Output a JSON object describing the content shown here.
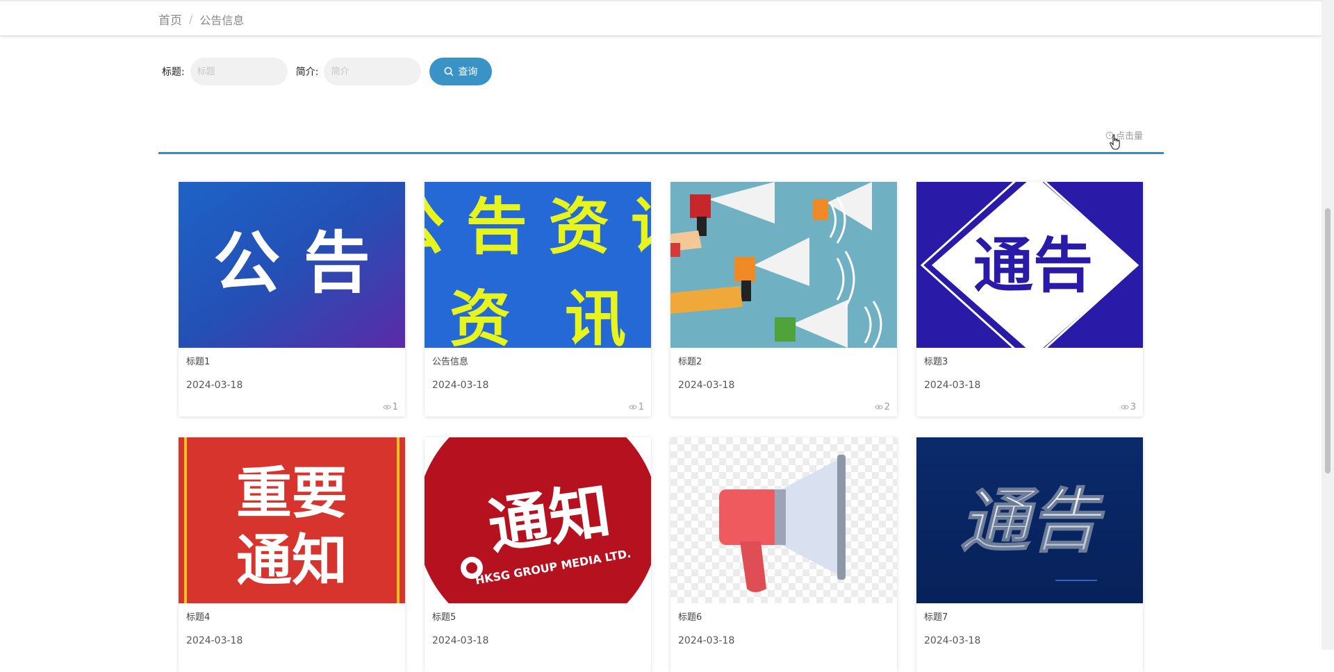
{
  "breadcrumb": {
    "home": "首页",
    "separator": "/",
    "current": "公告信息"
  },
  "search": {
    "title_label": "标题:",
    "title_placeholder": "标题",
    "intro_label": "简介:",
    "intro_placeholder": "简介",
    "button_label": "查询",
    "button_color": "#3a93c7"
  },
  "sort": {
    "label": "点击量",
    "accent_color": "#3a89c0"
  },
  "cards": [
    {
      "title": "标题1",
      "date": "2024-03-18",
      "views": "1",
      "thumb_text": "公 告"
    },
    {
      "title": "公告信息",
      "date": "2024-03-18",
      "views": "1",
      "thumb_text": "公 告 资 讯"
    },
    {
      "title": "标题2",
      "date": "2024-03-18",
      "views": "2",
      "thumb_text": ""
    },
    {
      "title": "标题3",
      "date": "2024-03-18",
      "views": "3",
      "thumb_text": "通告"
    },
    {
      "title": "标题4",
      "date": "2024-03-18",
      "views": "",
      "thumb_text": "重要通知"
    },
    {
      "title": "标题5",
      "date": "2024-03-18",
      "views": "",
      "thumb_text": "通知",
      "thumb_subtext": "HKSG GROUP MEDIA LTD."
    },
    {
      "title": "标题6",
      "date": "2024-03-18",
      "views": "",
      "thumb_text": ""
    },
    {
      "title": "标题7",
      "date": "2024-03-18",
      "views": "",
      "thumb_text": "通告"
    }
  ]
}
